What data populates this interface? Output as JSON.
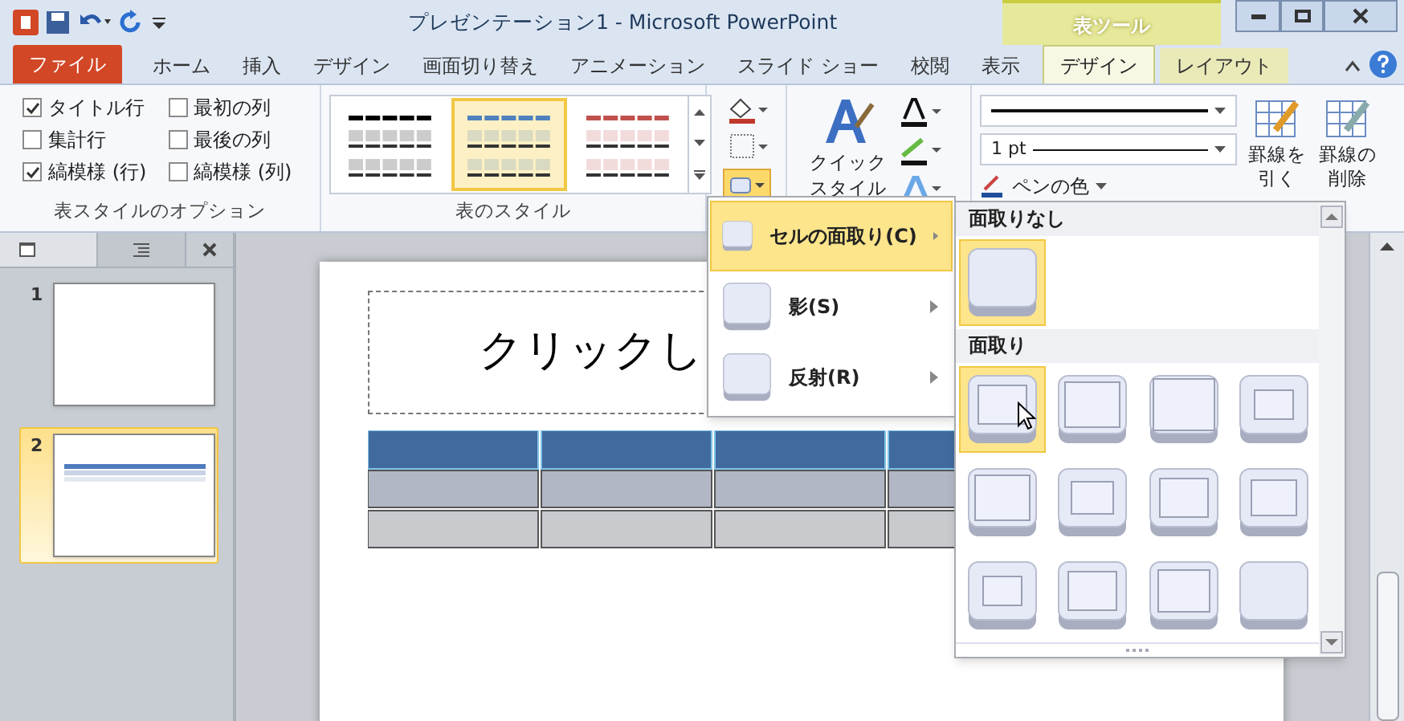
{
  "window": {
    "title": "プレゼンテーション1 - Microsoft PowerPoint",
    "context_tab": "表ツール"
  },
  "tabs": [
    {
      "label": "ファイル",
      "kind": "file",
      "selected": false
    },
    {
      "label": "ホーム",
      "kind": "normal",
      "selected": false
    },
    {
      "label": "挿入",
      "kind": "normal",
      "selected": false
    },
    {
      "label": "デザイン",
      "kind": "normal",
      "selected": false
    },
    {
      "label": "画面切り替え",
      "kind": "normal",
      "selected": false
    },
    {
      "label": "アニメーション",
      "kind": "normal",
      "selected": false
    },
    {
      "label": "スライド ショー",
      "kind": "normal",
      "selected": false
    },
    {
      "label": "校閲",
      "kind": "normal",
      "selected": false
    },
    {
      "label": "表示",
      "kind": "normal",
      "selected": false
    },
    {
      "label": "デザイン",
      "kind": "context",
      "selected": true
    },
    {
      "label": "レイアウト",
      "kind": "context",
      "selected": false
    }
  ],
  "style_options": {
    "label": "表スタイルのオプション",
    "options": [
      {
        "label": "タイトル行",
        "checked": true
      },
      {
        "label": "最初の列",
        "checked": false
      },
      {
        "label": "集計行",
        "checked": false
      },
      {
        "label": "最後の列",
        "checked": false
      },
      {
        "label": "縞模様 (行)",
        "checked": true
      },
      {
        "label": "縞模様 (列)",
        "checked": false
      }
    ]
  },
  "table_styles": {
    "label": "表のスタイル",
    "items": [
      {
        "color": "#000000",
        "selected": false
      },
      {
        "color": "#4f81bd",
        "selected": true
      },
      {
        "color": "#c0504d",
        "selected": false
      }
    ]
  },
  "wordart": {
    "label_lines": [
      "クイック",
      "スタイル"
    ]
  },
  "borders": {
    "weight": "1 pt",
    "pen_color": "ペンの色"
  },
  "draw_buttons": [
    {
      "kind": "draw",
      "lines": [
        "罫線を",
        "引く"
      ]
    },
    {
      "kind": "erase",
      "lines": [
        "罫線の",
        "削除"
      ]
    }
  ],
  "slides_pane": {
    "slides": [
      {
        "number": "1",
        "selected": false,
        "kind": "blank"
      },
      {
        "number": "2",
        "selected": true,
        "kind": "table"
      }
    ]
  },
  "slide": {
    "title": "クリックし"
  },
  "menu": {
    "items": [
      {
        "label": "セルの面取り(C)",
        "selected": true
      },
      {
        "label": "影(S)",
        "selected": false
      },
      {
        "label": "反射(R)",
        "selected": false
      }
    ]
  },
  "gallery": {
    "sections": [
      {
        "title": "面取りなし",
        "items": [
          {
            "selected": true
          }
        ]
      },
      {
        "title": "面取り",
        "items": [
          {
            "selected": true
          },
          {
            "selected": false
          },
          {
            "selected": false
          },
          {
            "selected": false
          },
          {
            "selected": false
          },
          {
            "selected": false
          },
          {
            "selected": false
          },
          {
            "selected": false
          },
          {
            "selected": false
          },
          {
            "selected": false
          },
          {
            "selected": false
          },
          {
            "selected": false
          }
        ]
      }
    ]
  }
}
